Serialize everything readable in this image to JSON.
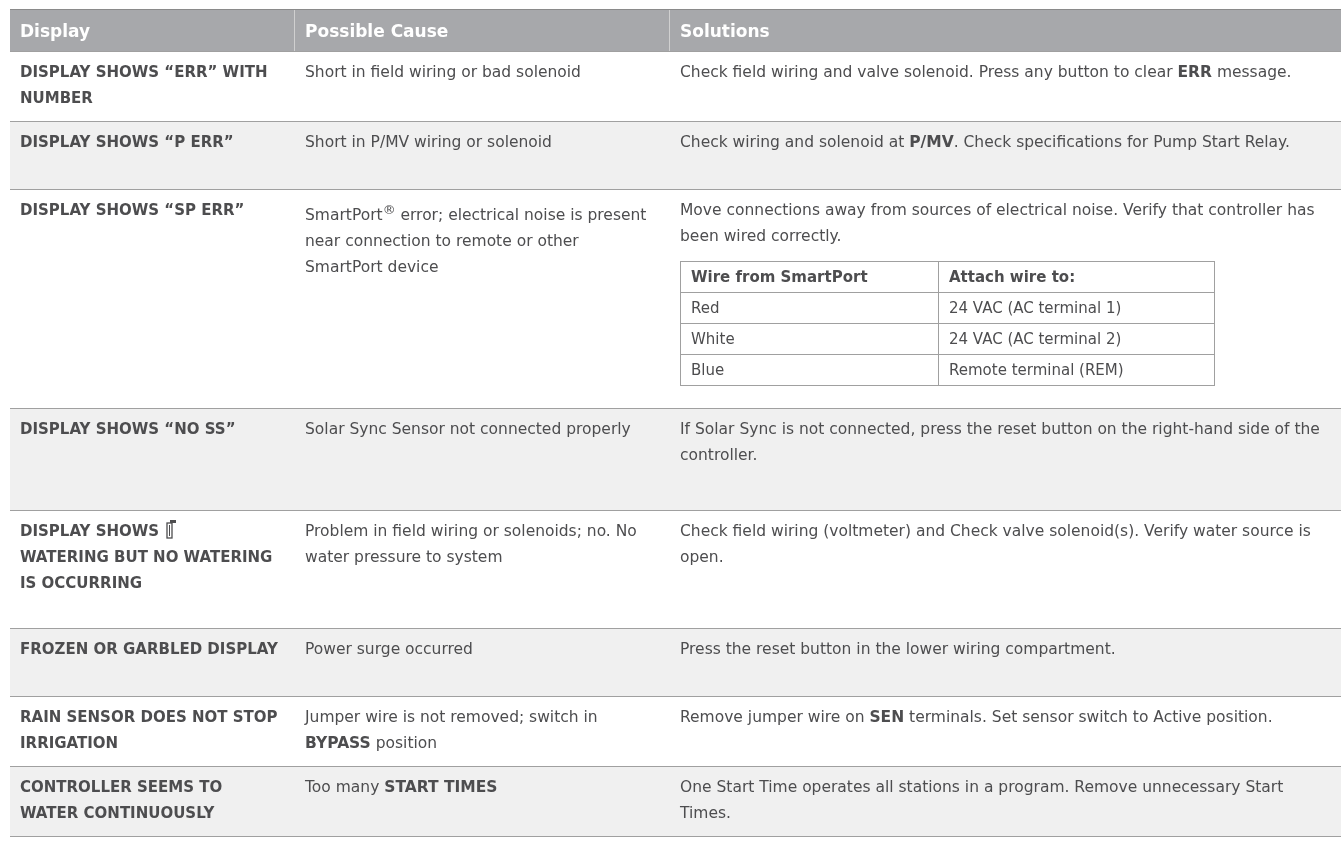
{
  "table": {
    "columns": [
      "Display",
      "Possible Cause",
      "Solutions"
    ],
    "rows": [
      {
        "display": [
          {
            "text": "DISPLAY SHOWS “ERR” WITH NUMBER"
          }
        ],
        "cause": "Short in field wiring or bad solenoid",
        "solution": "Check field wiring and valve solenoid. Press any button to clear **ERR** message."
      },
      {
        "display": [
          {
            "text": "DISPLAY SHOWS “P ERR”"
          }
        ],
        "cause": "Short in P/MV wiring or solenoid",
        "solution": "Check wiring and solenoid at **P/MV**. Check specifications for Pump Start Relay."
      },
      {
        "display": [
          {
            "text": "DISPLAY SHOWS “SP ERR”"
          }
        ],
        "cause": "SmartPort$^{®}$ error; electrical noise is present near connection to remote or other SmartPort device",
        "solution": "Move connections away from sources of electrical noise. Verify that controller has been wired correctly.",
        "wire_table": {
          "columns": [
            "Wire from SmartPort",
            "Attach wire to:"
          ],
          "rows": [
            [
              "Red",
              "24 VAC (AC terminal 1)"
            ],
            [
              "White",
              "24 VAC (AC terminal 2)"
            ],
            [
              "Blue",
              "Remote terminal (REM)"
            ]
          ]
        }
      },
      {
        "display": [
          {
            "text": "DISPLAY SHOWS “NO SS”"
          }
        ],
        "cause": "Solar Sync Sensor not connected properly",
        "solution": "If Solar Sync is not connected, press the reset button on the right-hand side of the controller."
      },
      {
        "display": [
          {
            "text": "DISPLAY SHOWS"
          },
          {
            "kind": "icon"
          },
          {
            "text": "WATERING BUT NO WATERING IS OCCURRING"
          }
        ],
        "cause": "Problem in field wiring or solenoids; no. No water pressure to system",
        "solution": "Check field wiring (voltmeter) and Check valve solenoid(s). Verify water source is open."
      },
      {
        "display": [
          {
            "text": "FROZEN OR GARBLED DISPLAY"
          }
        ],
        "cause": "Power surge occurred",
        "solution": "Press the reset button in the lower wiring compartment."
      },
      {
        "display": [
          {
            "text": "RAIN SENSOR DOES NOT STOP IRRIGATION"
          }
        ],
        "cause": "Jumper wire is not removed; switch in **BYPASS** position",
        "solution": "Remove jumper wire on **SEN** terminals. Set sensor switch to Active position."
      },
      {
        "display": [
          {
            "text": "CONTROLLER SEEMS TO WATER CONTINUOUSLY"
          }
        ],
        "cause": "Too many **START TIMES**",
        "solution": "One Start Time operates all stations in a program. Remove unnecessary Start Times."
      }
    ]
  }
}
